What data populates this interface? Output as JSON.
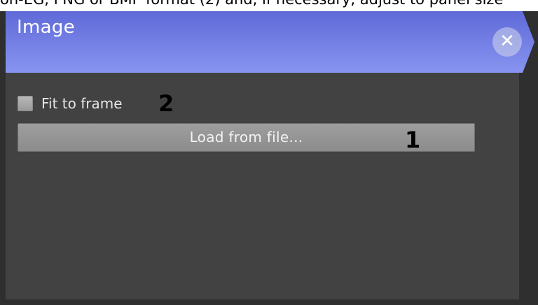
{
  "top_caption": "on-EG, PNG or BMP format (2) and, if necessary, adjust to panel size",
  "panel": {
    "title": "Image",
    "header_colors": {
      "top": "#5f6ad8",
      "bottom": "#8894f0"
    },
    "close_icon": "close-icon",
    "close_glyph": "✕"
  },
  "fit_to_frame": {
    "label": "Fit to frame",
    "checked": false
  },
  "load_button": {
    "label": "Load from file..."
  },
  "callouts": {
    "one": "1",
    "two": "2"
  }
}
